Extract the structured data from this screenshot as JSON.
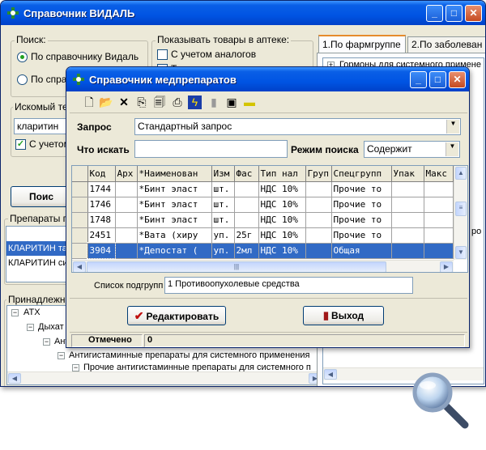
{
  "main_window": {
    "title": "Справочник ВИДАЛЬ",
    "search_group": {
      "legend": "Поиск:",
      "options": [
        "По справочнику Видаль",
        "По справ"
      ]
    },
    "show_group": {
      "legend": "Показывать товары в аптеке:",
      "options": [
        "С учетом аналогов",
        "Т"
      ]
    },
    "search_text_group": {
      "legend": "Искомый те",
      "value": "кларитин",
      "checkbox_label": "С учетом"
    },
    "search_button": "Поис",
    "preparations_group": {
      "legend": "Препараты по",
      "items": [
        "КЛАРИТИН таб",
        "КЛАРИТИН сир"
      ]
    },
    "belongs_group": {
      "legend": "Принадлежно",
      "tree": [
        "АТХ",
        "Дыхат",
        "Анти",
        "Антигистаминные препараты для системного применения",
        "Прочие антигистаминные препараты для системного п"
      ]
    },
    "tabs": [
      "1.По фармгруппе",
      "2.По заболеван"
    ],
    "right_tree": [
      "Гормоны для системного примене",
      "ро"
    ]
  },
  "dialog": {
    "title": "Справочник медпрепаратов",
    "toolbar_icons": [
      "new-icon",
      "open-icon",
      "delete-icon",
      "copy-icon",
      "preview-icon",
      "print-icon",
      "lightning-icon",
      "disk-icon",
      "image-icon",
      "highlighter-icon"
    ],
    "query_label": "Запрос",
    "query_value": "Стандартный запрос",
    "find_label": "Что искать",
    "find_value": "",
    "mode_label": "Режим поиска",
    "mode_value": "Содержит",
    "columns": [
      "Код",
      "Арх",
      "*Наименован",
      "Изм",
      "Фас",
      "Тип нал",
      "Груп",
      "Спецгрупп",
      "Упак",
      "Макс"
    ],
    "rows": [
      [
        "1744",
        "",
        "*Бинт эласт",
        "шт.",
        "",
        "НДС 10%",
        "",
        "Прочие то",
        "",
        ""
      ],
      [
        "1746",
        "",
        "*Бинт эласт",
        "шт.",
        "",
        "НДС 10%",
        "",
        "Прочие то",
        "",
        ""
      ],
      [
        "1748",
        "",
        "*Бинт эласт",
        "шт.",
        "",
        "НДС 10%",
        "",
        "Прочие то",
        "",
        ""
      ],
      [
        "2451",
        "",
        "*Вата (хиру",
        "уп.",
        "25г",
        "НДС 10%",
        "",
        "Прочие то",
        "",
        ""
      ],
      [
        "3904",
        "",
        "*Депостат (",
        "уп.",
        "2мл",
        "НДС 10%",
        "",
        "Общая",
        "",
        ""
      ]
    ],
    "selected_row": 4,
    "subgroup_label": "Список подгрупп",
    "subgroup_value": "1 Противоопухолевые средства",
    "edit_button": "Редактировать",
    "exit_button": "Выход",
    "status_label": "Отмечено",
    "status_value": "0"
  },
  "colors": {
    "titlebar": "#0054e3",
    "selection": "#316ac5",
    "window_bg": "#ece9d8"
  }
}
